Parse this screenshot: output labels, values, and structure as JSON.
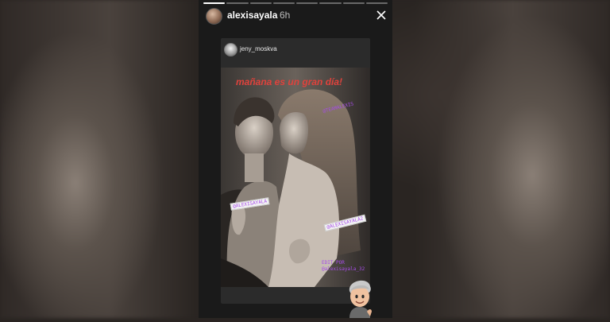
{
  "story": {
    "username": "alexisayala",
    "time": "6h",
    "progress_segments": 8,
    "progress_filled": 1
  },
  "repost": {
    "username": "jeny_moskva",
    "caption": "mañana es un gran día!",
    "tags": {
      "top_right": "@TEAMALEXIS",
      "left": "@ALEXISAYALA",
      "right": "@ALEXISAYALA2",
      "credit_line1": "EDIT POR",
      "credit_line2": "@alexisayala_32"
    }
  },
  "icons": {
    "close": "close-icon",
    "memoji": "memoji-sticker"
  },
  "colors": {
    "caption": "#e0423c",
    "tag": "#a64ce8"
  }
}
